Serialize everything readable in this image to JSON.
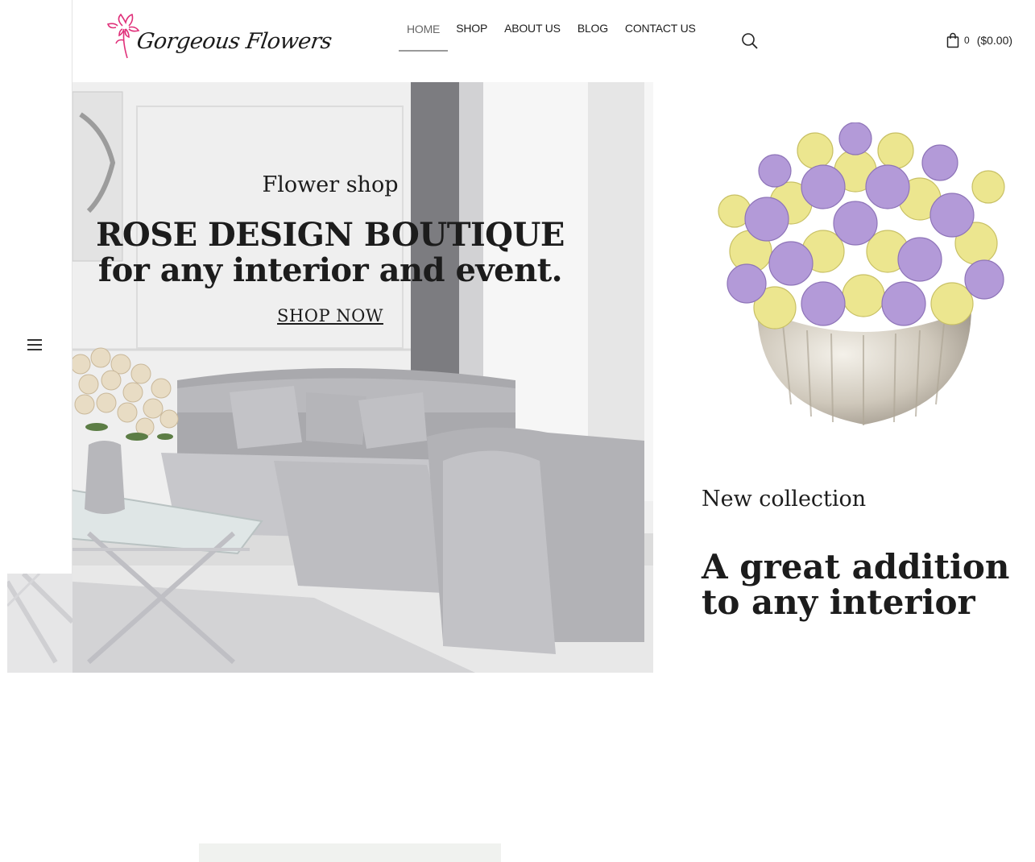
{
  "brand": {
    "name": "Gorgeous Flowers"
  },
  "nav": {
    "items": [
      {
        "label": "HOME",
        "active": true
      },
      {
        "label": "SHOP"
      },
      {
        "label": "ABOUT US"
      },
      {
        "label": "BLOG"
      },
      {
        "label": "CONTACT US"
      }
    ]
  },
  "header": {
    "search_icon": "search-icon",
    "cart": {
      "icon": "shopping-bag-icon",
      "count": "0",
      "total": "($0.00)"
    }
  },
  "sidebar": {
    "menu_icon": "hamburger-icon"
  },
  "hero": {
    "subtitle": "Flower shop",
    "title_line1": "ROSE DESIGN BOUTIQUE",
    "title_line2": "for any interior and event.",
    "cta": "SHOP NOW"
  },
  "collection": {
    "subtitle": "New collection",
    "title_line1": "A great addition",
    "title_line2": "to any interior"
  },
  "colors": {
    "text": "#1c1c1c",
    "nav_active": "#666666",
    "lavender_rose": "#b39ad8",
    "yellow_rose": "#ece68f",
    "logo_accent": "#e0307a"
  }
}
